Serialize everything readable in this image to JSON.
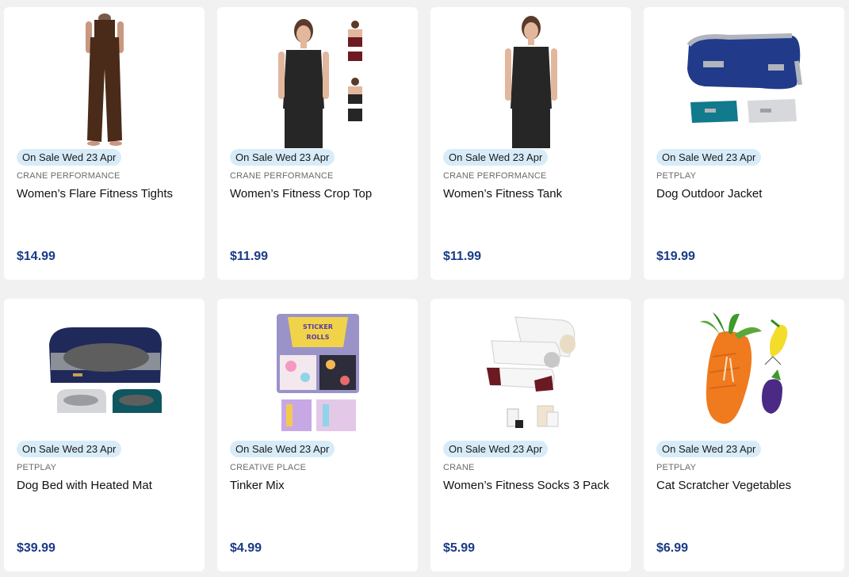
{
  "products": [
    {
      "badge": "On Sale Wed 23 Apr",
      "brand": "CRANE PERFORMANCE",
      "name": "Women’s Flare Fitness Tights",
      "price": "$14.99",
      "image": "flare-tights-photo"
    },
    {
      "badge": "On Sale Wed 23 Apr",
      "brand": "CRANE PERFORMANCE",
      "name": "Women’s Fitness Crop Top",
      "price": "$11.99",
      "image": "crop-top-photo"
    },
    {
      "badge": "On Sale Wed 23 Apr",
      "brand": "CRANE PERFORMANCE",
      "name": "Women’s Fitness Tank",
      "price": "$11.99",
      "image": "fitness-tank-photo"
    },
    {
      "badge": "On Sale Wed 23 Apr",
      "brand": "PETPLAY",
      "name": "Dog Outdoor Jacket",
      "price": "$19.99",
      "image": "dog-jacket-photo"
    },
    {
      "badge": "On Sale Wed 23 Apr",
      "brand": "PETPLAY",
      "name": "Dog Bed with Heated Mat",
      "price": "$39.99",
      "image": "dog-bed-photo"
    },
    {
      "badge": "On Sale Wed 23 Apr",
      "brand": "CREATIVE PLACE",
      "name": "Tinker Mix",
      "price": "$4.99",
      "image": "sticker-rolls-photo"
    },
    {
      "badge": "On Sale Wed 23 Apr",
      "brand": "CRANE",
      "name": "Women’s Fitness Socks 3 Pack",
      "price": "$5.99",
      "image": "fitness-socks-photo"
    },
    {
      "badge": "On Sale Wed 23 Apr",
      "brand": "PETPLAY",
      "name": "Cat Scratcher Vegetables",
      "price": "$6.99",
      "image": "cat-scratcher-photo"
    }
  ],
  "sticker_label": [
    "STICKER",
    "ROLLS"
  ],
  "colors": {
    "badge_bg": "#d7ecf8",
    "price": "#1a3a86",
    "card_bg": "#ffffff",
    "page_bg": "#f1f1f1"
  }
}
